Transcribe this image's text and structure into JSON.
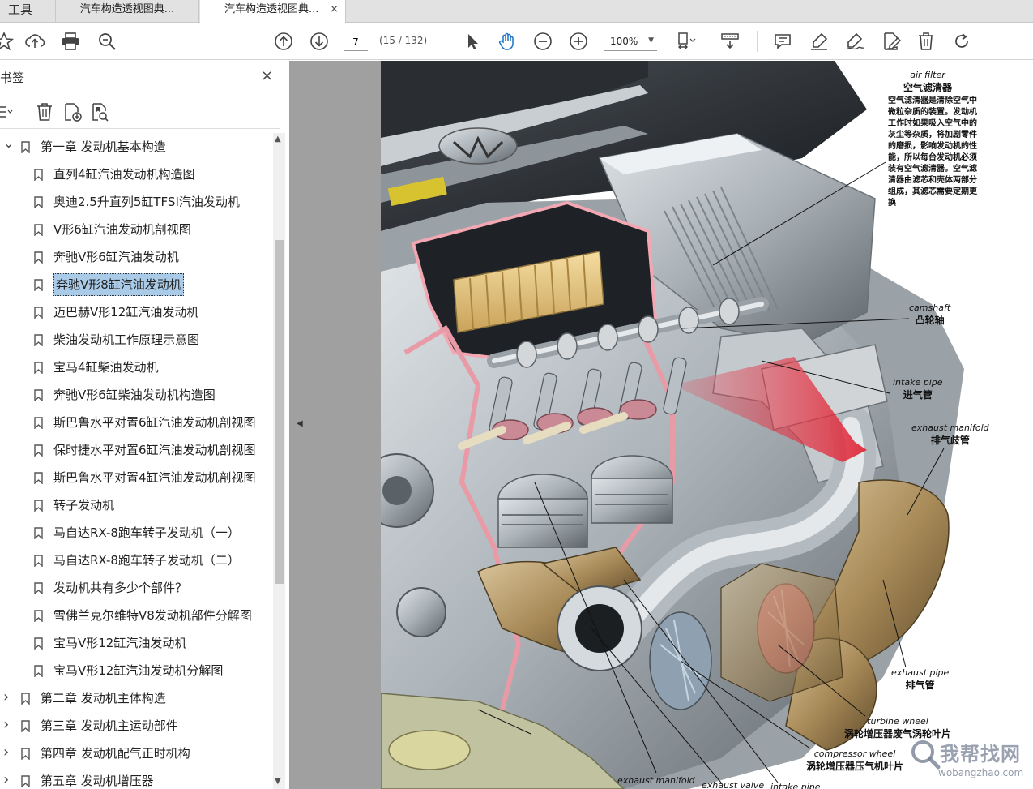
{
  "tabs": {
    "tools": "工具",
    "doc1": "汽车构造透视图典...",
    "doc2": "汽车构造透视图典...",
    "close": "×"
  },
  "toolbar": {
    "page_number": "7",
    "page_count": "(15 / 132)",
    "zoom": "100%",
    "icons": [
      "star-icon",
      "upload-icon",
      "print-icon",
      "zoom-search-icon",
      "page-up-icon",
      "page-down-icon",
      "select-arrow-icon",
      "hand-icon",
      "zoom-out-icon",
      "zoom-in-icon",
      "page-fit-icon",
      "scroll-mode-icon",
      "comment-icon",
      "highlight-icon",
      "sign-icon",
      "edit-icon",
      "delete-icon",
      "rotate-icon"
    ]
  },
  "sidebar": {
    "title": "书签",
    "close": "×",
    "bookmarks": [
      {
        "label": "第一章 发动机基本构造",
        "level": 0,
        "expanded": true
      },
      {
        "label": "直列4缸汽油发动机构造图",
        "level": 1
      },
      {
        "label": "奥迪2.5升直列5缸TFSI汽油发动机",
        "level": 1
      },
      {
        "label": "V形6缸汽油发动机剖视图",
        "level": 1
      },
      {
        "label": "奔驰V形6缸汽油发动机",
        "level": 1
      },
      {
        "label": "奔驰V形8缸汽油发动机",
        "level": 1,
        "selected": true
      },
      {
        "label": "迈巴赫V形12缸汽油发动机",
        "level": 1
      },
      {
        "label": "柴油发动机工作原理示意图",
        "level": 1
      },
      {
        "label": "宝马4缸柴油发动机",
        "level": 1
      },
      {
        "label": "奔驰V形6缸柴油发动机构造图",
        "level": 1
      },
      {
        "label": "斯巴鲁水平对置6缸汽油发动机剖视图",
        "level": 1
      },
      {
        "label": "保时捷水平对置6缸汽油发动机剖视图",
        "level": 1
      },
      {
        "label": "斯巴鲁水平对置4缸汽油发动机剖视图",
        "level": 1
      },
      {
        "label": "转子发动机",
        "level": 1
      },
      {
        "label": "马自达RX-8跑车转子发动机（一）",
        "level": 1
      },
      {
        "label": "马自达RX-8跑车转子发动机（二）",
        "level": 1
      },
      {
        "label": "发动机共有多少个部件？",
        "level": 1
      },
      {
        "label": "雪佛兰克尔维特V8发动机部件分解图",
        "level": 1
      },
      {
        "label": "宝马V形12缸汽油发动机",
        "level": 1
      },
      {
        "label": "宝马V形12缸汽油发动机分解图",
        "level": 1
      },
      {
        "label": "第二章 发动机主体构造",
        "level": 0
      },
      {
        "label": "第三章 发动机主运动部件",
        "level": 0
      },
      {
        "label": "第四章 发动机配气正时机构",
        "level": 0
      },
      {
        "label": "第五章 发动机增压器",
        "level": 0
      }
    ]
  },
  "page": {
    "annotations": {
      "air_filter_en": "air filter",
      "air_filter_zh": "空气滤清器",
      "air_filter_desc": "空气滤清器是清除空气中微粒杂质的装置。发动机工作时如果吸入空气中的灰尘等杂质，将加剧零件的磨损，影响发动机的性能，所以每台发动机必须装有空气滤清器。空气滤清器由滤芯和壳体两部分组成，其滤芯需要定期更换",
      "camshaft_en": "camshaft",
      "camshaft_zh": "凸轮轴",
      "intake_pipe_en": "intake pipe",
      "intake_pipe_zh": "进气管",
      "exhaust_manifold_en": "exhaust manifold",
      "exhaust_manifold_zh": "排气歧管",
      "exhaust_pipe_en": "exhaust pipe",
      "exhaust_pipe_zh": "排气管",
      "turbine_wheel_en": "turbine wheel",
      "turbine_wheel_zh": "涡轮增压器废气涡轮叶片",
      "compressor_wheel_en": "compressor wheel",
      "compressor_wheel_zh": "涡轮增压器压气机叶片",
      "exhaust_manifold_bottom_en": "exhaust manifold",
      "exhaust_valve_en": "exhaust valve",
      "intake_pipe_bottom_en": "intake pipe"
    }
  },
  "watermark": {
    "text": "我帮找网",
    "url": "wobangzhao.com"
  }
}
